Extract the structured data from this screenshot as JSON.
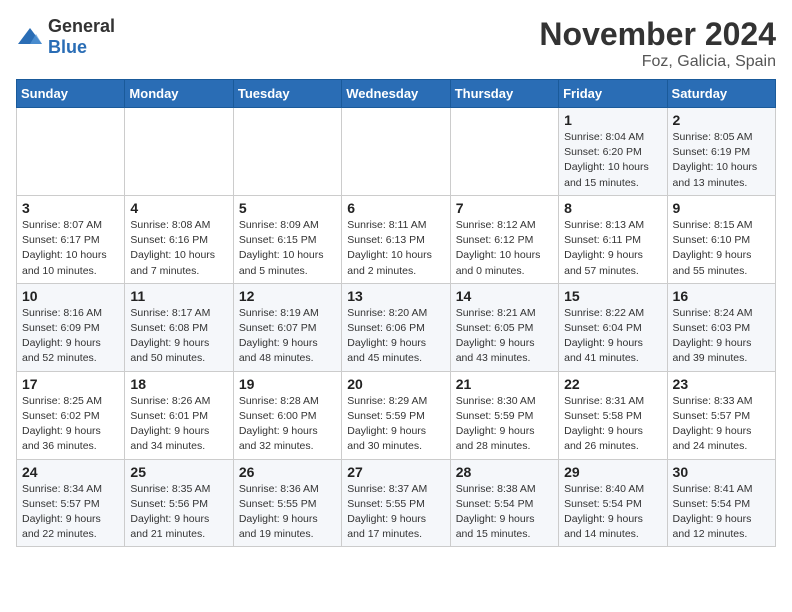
{
  "header": {
    "logo_general": "General",
    "logo_blue": "Blue",
    "title": "November 2024",
    "location": "Foz, Galicia, Spain"
  },
  "days_of_week": [
    "Sunday",
    "Monday",
    "Tuesday",
    "Wednesday",
    "Thursday",
    "Friday",
    "Saturday"
  ],
  "weeks": [
    [
      {
        "day": "",
        "info": ""
      },
      {
        "day": "",
        "info": ""
      },
      {
        "day": "",
        "info": ""
      },
      {
        "day": "",
        "info": ""
      },
      {
        "day": "",
        "info": ""
      },
      {
        "day": "1",
        "info": "Sunrise: 8:04 AM\nSunset: 6:20 PM\nDaylight: 10 hours and 15 minutes."
      },
      {
        "day": "2",
        "info": "Sunrise: 8:05 AM\nSunset: 6:19 PM\nDaylight: 10 hours and 13 minutes."
      }
    ],
    [
      {
        "day": "3",
        "info": "Sunrise: 8:07 AM\nSunset: 6:17 PM\nDaylight: 10 hours and 10 minutes."
      },
      {
        "day": "4",
        "info": "Sunrise: 8:08 AM\nSunset: 6:16 PM\nDaylight: 10 hours and 7 minutes."
      },
      {
        "day": "5",
        "info": "Sunrise: 8:09 AM\nSunset: 6:15 PM\nDaylight: 10 hours and 5 minutes."
      },
      {
        "day": "6",
        "info": "Sunrise: 8:11 AM\nSunset: 6:13 PM\nDaylight: 10 hours and 2 minutes."
      },
      {
        "day": "7",
        "info": "Sunrise: 8:12 AM\nSunset: 6:12 PM\nDaylight: 10 hours and 0 minutes."
      },
      {
        "day": "8",
        "info": "Sunrise: 8:13 AM\nSunset: 6:11 PM\nDaylight: 9 hours and 57 minutes."
      },
      {
        "day": "9",
        "info": "Sunrise: 8:15 AM\nSunset: 6:10 PM\nDaylight: 9 hours and 55 minutes."
      }
    ],
    [
      {
        "day": "10",
        "info": "Sunrise: 8:16 AM\nSunset: 6:09 PM\nDaylight: 9 hours and 52 minutes."
      },
      {
        "day": "11",
        "info": "Sunrise: 8:17 AM\nSunset: 6:08 PM\nDaylight: 9 hours and 50 minutes."
      },
      {
        "day": "12",
        "info": "Sunrise: 8:19 AM\nSunset: 6:07 PM\nDaylight: 9 hours and 48 minutes."
      },
      {
        "day": "13",
        "info": "Sunrise: 8:20 AM\nSunset: 6:06 PM\nDaylight: 9 hours and 45 minutes."
      },
      {
        "day": "14",
        "info": "Sunrise: 8:21 AM\nSunset: 6:05 PM\nDaylight: 9 hours and 43 minutes."
      },
      {
        "day": "15",
        "info": "Sunrise: 8:22 AM\nSunset: 6:04 PM\nDaylight: 9 hours and 41 minutes."
      },
      {
        "day": "16",
        "info": "Sunrise: 8:24 AM\nSunset: 6:03 PM\nDaylight: 9 hours and 39 minutes."
      }
    ],
    [
      {
        "day": "17",
        "info": "Sunrise: 8:25 AM\nSunset: 6:02 PM\nDaylight: 9 hours and 36 minutes."
      },
      {
        "day": "18",
        "info": "Sunrise: 8:26 AM\nSunset: 6:01 PM\nDaylight: 9 hours and 34 minutes."
      },
      {
        "day": "19",
        "info": "Sunrise: 8:28 AM\nSunset: 6:00 PM\nDaylight: 9 hours and 32 minutes."
      },
      {
        "day": "20",
        "info": "Sunrise: 8:29 AM\nSunset: 5:59 PM\nDaylight: 9 hours and 30 minutes."
      },
      {
        "day": "21",
        "info": "Sunrise: 8:30 AM\nSunset: 5:59 PM\nDaylight: 9 hours and 28 minutes."
      },
      {
        "day": "22",
        "info": "Sunrise: 8:31 AM\nSunset: 5:58 PM\nDaylight: 9 hours and 26 minutes."
      },
      {
        "day": "23",
        "info": "Sunrise: 8:33 AM\nSunset: 5:57 PM\nDaylight: 9 hours and 24 minutes."
      }
    ],
    [
      {
        "day": "24",
        "info": "Sunrise: 8:34 AM\nSunset: 5:57 PM\nDaylight: 9 hours and 22 minutes."
      },
      {
        "day": "25",
        "info": "Sunrise: 8:35 AM\nSunset: 5:56 PM\nDaylight: 9 hours and 21 minutes."
      },
      {
        "day": "26",
        "info": "Sunrise: 8:36 AM\nSunset: 5:55 PM\nDaylight: 9 hours and 19 minutes."
      },
      {
        "day": "27",
        "info": "Sunrise: 8:37 AM\nSunset: 5:55 PM\nDaylight: 9 hours and 17 minutes."
      },
      {
        "day": "28",
        "info": "Sunrise: 8:38 AM\nSunset: 5:54 PM\nDaylight: 9 hours and 15 minutes."
      },
      {
        "day": "29",
        "info": "Sunrise: 8:40 AM\nSunset: 5:54 PM\nDaylight: 9 hours and 14 minutes."
      },
      {
        "day": "30",
        "info": "Sunrise: 8:41 AM\nSunset: 5:54 PM\nDaylight: 9 hours and 12 minutes."
      }
    ]
  ]
}
